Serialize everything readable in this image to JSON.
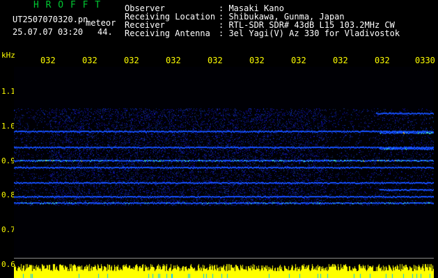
{
  "header": {
    "app_title": "H R O F F T",
    "file_name": "UT2507070320.pn",
    "file_tag": "meteor",
    "timestamp": "25.07.07 03:20",
    "count_value": "44."
  },
  "info": [
    {
      "label": "Observer",
      "value": ": Masaki Kano"
    },
    {
      "label": "Receiving Location",
      "value": ": Shibukawa, Gunma, Japan"
    },
    {
      "label": "Receiver",
      "value": ": RTL-SDR SDR# 43dB L15 103.2MHz CW"
    },
    {
      "label": "Receiving Antenna",
      "value": ": 3el Yagi(V) Az 330 for Vladivostok"
    }
  ],
  "axis": {
    "unit": "kHz",
    "time_ticks": [
      "032",
      "032",
      "032",
      "032",
      "032",
      "032",
      "032",
      "032",
      "032",
      "0330"
    ],
    "freq_ticks": [
      "1.1",
      "1.0",
      "0.9",
      "0.8",
      "0.7",
      "0.6"
    ]
  },
  "colors": {
    "label_white": "#ffffff",
    "accent_yellow": "#ffff00",
    "title_green": "#00c832",
    "level_bar": "#ffff00",
    "spectrogram_bg": "#000005"
  }
}
